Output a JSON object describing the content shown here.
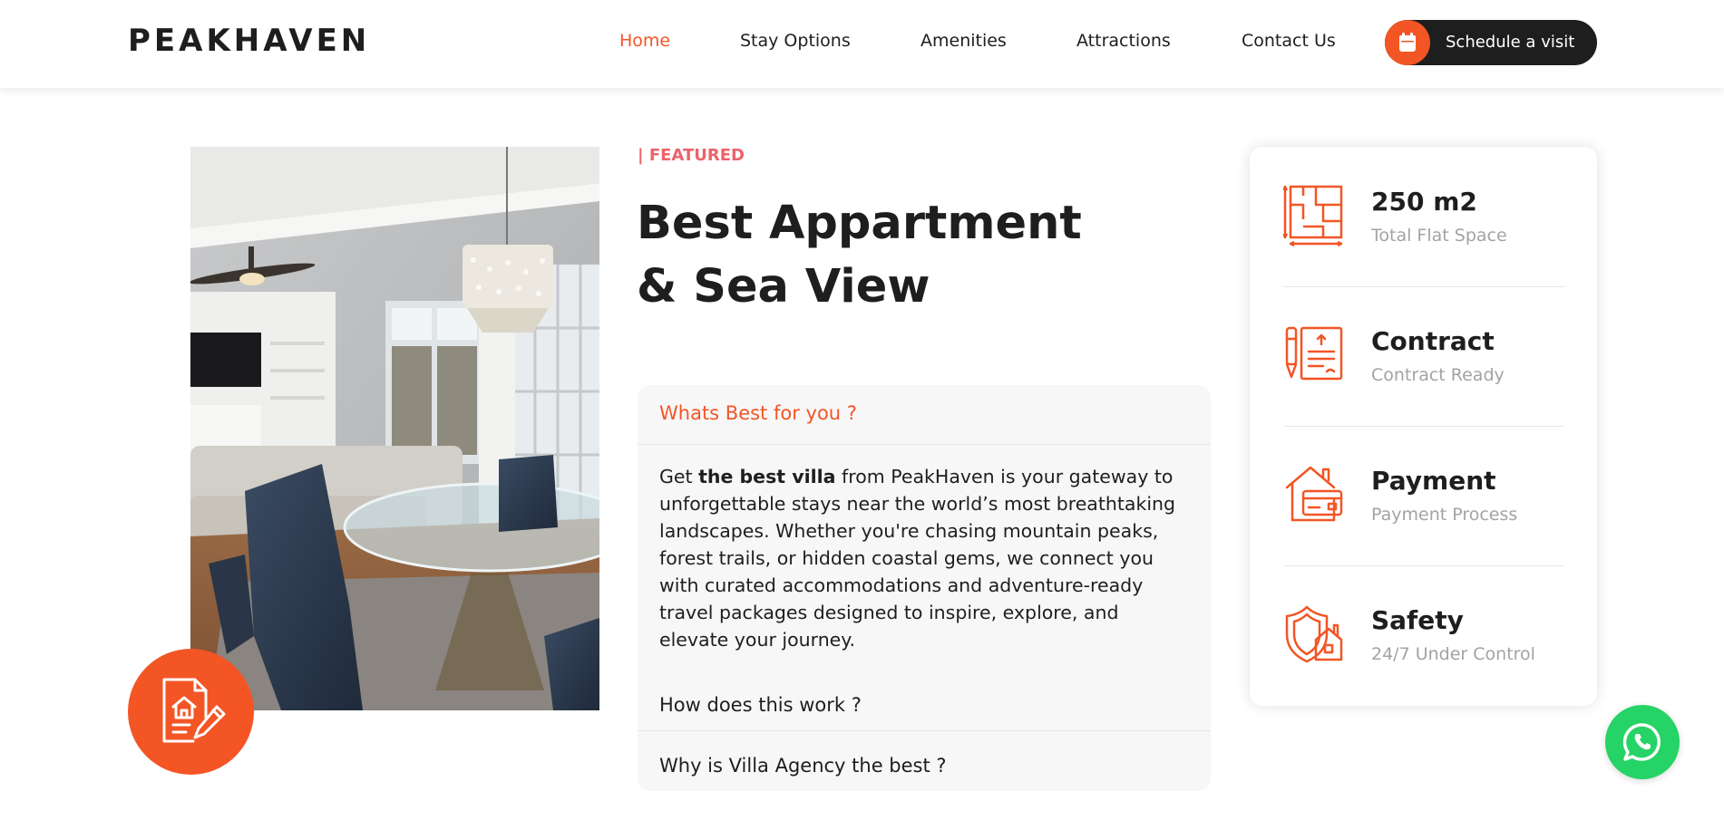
{
  "brand": {
    "name": "PEAKHAVEN"
  },
  "nav": {
    "items": [
      {
        "label": "Home",
        "active": true
      },
      {
        "label": "Stay Options",
        "active": false
      },
      {
        "label": "Amenities",
        "active": false
      },
      {
        "label": "Attractions",
        "active": false
      },
      {
        "label": "Contact Us",
        "active": false
      }
    ],
    "cta": {
      "label": "Schedule a visit",
      "icon": "calendar-icon"
    }
  },
  "colors": {
    "accent": "#f35525",
    "dark": "#1e1e1e",
    "eyebrow": "#ee626b",
    "muted": "#a3a3a3",
    "panel": "#f7f7f7",
    "whatsapp": "#25d366"
  },
  "featured": {
    "eyebrow": "| FEATURED",
    "headline_line1": "Best Appartment",
    "headline_line2": "& Sea View"
  },
  "accordion": {
    "items": [
      {
        "title": "Whats Best for you ?",
        "open": true,
        "body_before": "Get ",
        "body_bold": "the best villa",
        "body_after": " from PeakHaven is your gateway to unforgettable stays near the world’s most breathtaking landscapes. Whether you're chasing mountain peaks, forest trails, or hidden coastal gems, we connect you with curated accommodations and adventure-ready travel packages designed to inspire, explore, and elevate your journey."
      },
      {
        "title": "How does this work ?",
        "open": false
      },
      {
        "title": "Why is Villa Agency the best ?",
        "open": false
      }
    ]
  },
  "features": [
    {
      "title": "250 m2",
      "subtitle": "Total Flat Space",
      "icon": "floor-plan-icon"
    },
    {
      "title": "Contract",
      "subtitle": "Contract Ready",
      "icon": "contract-icon"
    },
    {
      "title": "Payment",
      "subtitle": "Payment Process",
      "icon": "payment-icon"
    },
    {
      "title": "Safety",
      "subtitle": "24/7 Under Control",
      "icon": "safety-icon"
    }
  ],
  "badge": {
    "icon": "house-document-icon"
  },
  "floating": {
    "icon": "whatsapp-icon"
  }
}
